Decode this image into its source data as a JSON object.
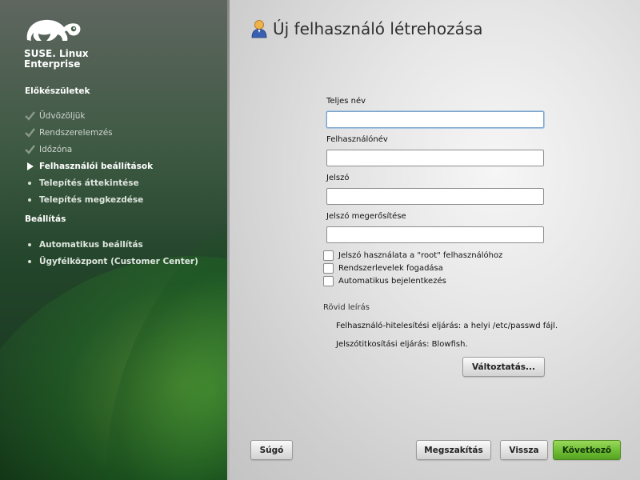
{
  "sidebar": {
    "brand_line1": "SUSE. Linux",
    "brand_line2": "Enterprise",
    "sections": {
      "prep": "Előkészületek",
      "config": "Beállítás"
    },
    "steps": [
      {
        "label": "Üdvözöljük",
        "state": "done",
        "icon": "check-icon"
      },
      {
        "label": "Rendszerelemzés",
        "state": "done",
        "icon": "check-icon"
      },
      {
        "label": "Időzóna",
        "state": "done",
        "icon": "check-icon"
      },
      {
        "label": "Felhasználói beállítások",
        "state": "current",
        "icon": "arrow-right-icon"
      },
      {
        "label": "Telepítés áttekintése",
        "state": "todo",
        "icon": "bullet-icon"
      },
      {
        "label": "Telepítés megkezdése",
        "state": "todo",
        "icon": "bullet-icon"
      },
      {
        "label": "Automatikus beállítás",
        "state": "todo",
        "icon": "bullet-icon"
      },
      {
        "label": "Ügyfélközpont (Customer Center)",
        "state": "todo",
        "icon": "bullet-icon"
      }
    ]
  },
  "main": {
    "title": "Új felhasználó létrehozása",
    "title_icon": "user-icon",
    "fields": [
      {
        "label": "Teljes név",
        "value": ""
      },
      {
        "label": "Felhasználónév",
        "value": ""
      },
      {
        "label": "Jelszó",
        "value": ""
      },
      {
        "label": "Jelszó megerősítése",
        "value": ""
      }
    ],
    "checkboxes": [
      {
        "label": "Jelszó használata a \"root\" felhasználóhoz",
        "checked": false
      },
      {
        "label": "Rendszerlevelek fogadása",
        "checked": false
      },
      {
        "label": "Automatikus bejelentkezés",
        "checked": false
      }
    ],
    "summary_title": "Rövid leírás",
    "summary_lines": [
      "Felhasználó-hitelesítési eljárás: a helyi /etc/passwd fájl.",
      "Jelszótitkosítási eljárás: Blowfish."
    ],
    "change_button": "Változtatás..."
  },
  "footer": {
    "help": "Súgó",
    "abort": "Megszakítás",
    "back": "Vissza",
    "next": "Következő"
  },
  "colors": {
    "accent_green": "#6fbd35",
    "sidebar_dark": "#1c3d23"
  }
}
